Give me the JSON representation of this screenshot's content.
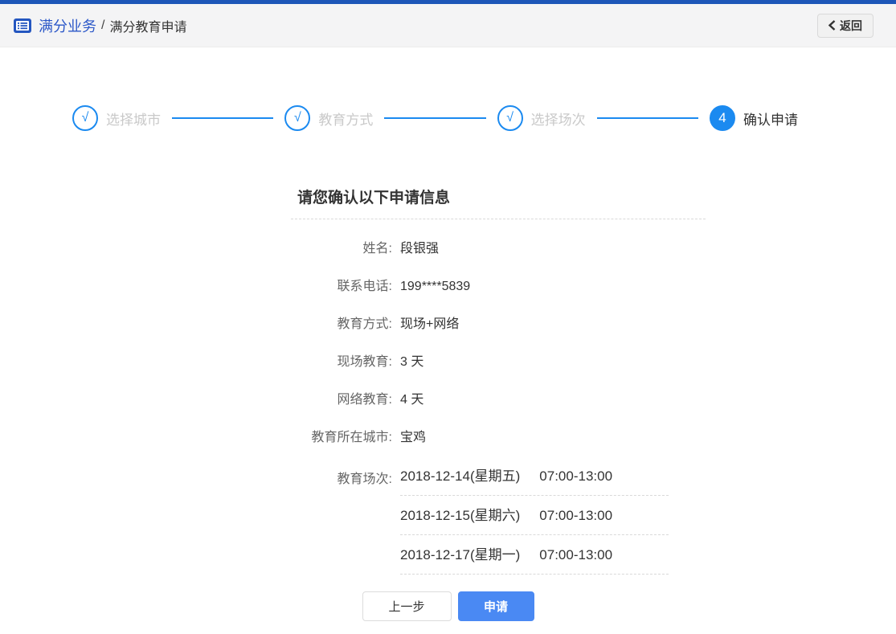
{
  "colors": {
    "topbar_blue": "#1d56b8",
    "brand_blue": "#2b57c8",
    "accent_blue": "#1b8af0",
    "button_blue": "#4a89f3"
  },
  "header": {
    "breadcrumb_root": "满分业务",
    "breadcrumb_separator": "/",
    "breadcrumb_current": "满分教育申请",
    "back_label": "返回"
  },
  "steps": [
    {
      "label": "选择城市",
      "symbol": "√",
      "state": "done"
    },
    {
      "label": "教育方式",
      "symbol": "√",
      "state": "done"
    },
    {
      "label": "选择场次",
      "symbol": "√",
      "state": "done"
    },
    {
      "label": "确认申请",
      "symbol": "4",
      "state": "current"
    }
  ],
  "form": {
    "title": "请您确认以下申请信息",
    "fields": [
      {
        "label": "姓名:",
        "value": "段银强"
      },
      {
        "label": "联系电话:",
        "value": "199****5839"
      },
      {
        "label": "教育方式:",
        "value": "现场+网络"
      },
      {
        "label": "现场教育:",
        "value": "3 天"
      },
      {
        "label": "网络教育:",
        "value": "4 天"
      },
      {
        "label": "教育所在城市:",
        "value": "宝鸡"
      }
    ],
    "sessions_label": "教育场次:",
    "sessions": [
      {
        "date": "2018-12-14(星期五)",
        "time": "07:00-13:00"
      },
      {
        "date": "2018-12-15(星期六)",
        "time": "07:00-13:00"
      },
      {
        "date": "2018-12-17(星期一)",
        "time": "07:00-13:00"
      }
    ],
    "buttons": {
      "prev": "上一步",
      "apply": "申请"
    }
  }
}
